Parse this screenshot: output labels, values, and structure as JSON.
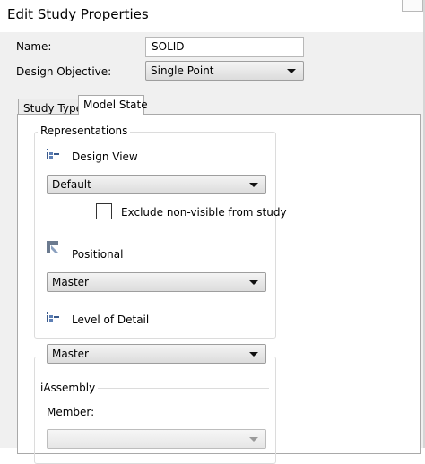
{
  "window": {
    "title": "Edit Study Properties"
  },
  "form": {
    "name_label": "Name:",
    "name_value": "SOLID",
    "objective_label": "Design Objective:",
    "objective_value": "Single Point"
  },
  "tabs": [
    {
      "label": "Study Type"
    },
    {
      "label": "Model State"
    }
  ],
  "representations": {
    "legend": "Representations",
    "design_view_label": "Design View",
    "design_view_value": "Default",
    "exclude_label": "Exclude non-visible from study",
    "exclude_checked": false,
    "positional_label": "Positional",
    "positional_value": "Master",
    "lod_label": "Level of Detail",
    "lod_value": "Master"
  },
  "iassembly": {
    "legend": "iAssembly",
    "member_label": "Member:",
    "member_value": ""
  },
  "icons": [
    "design-view-icon",
    "positional-icon",
    "level-of-detail-icon",
    "close-icon"
  ]
}
